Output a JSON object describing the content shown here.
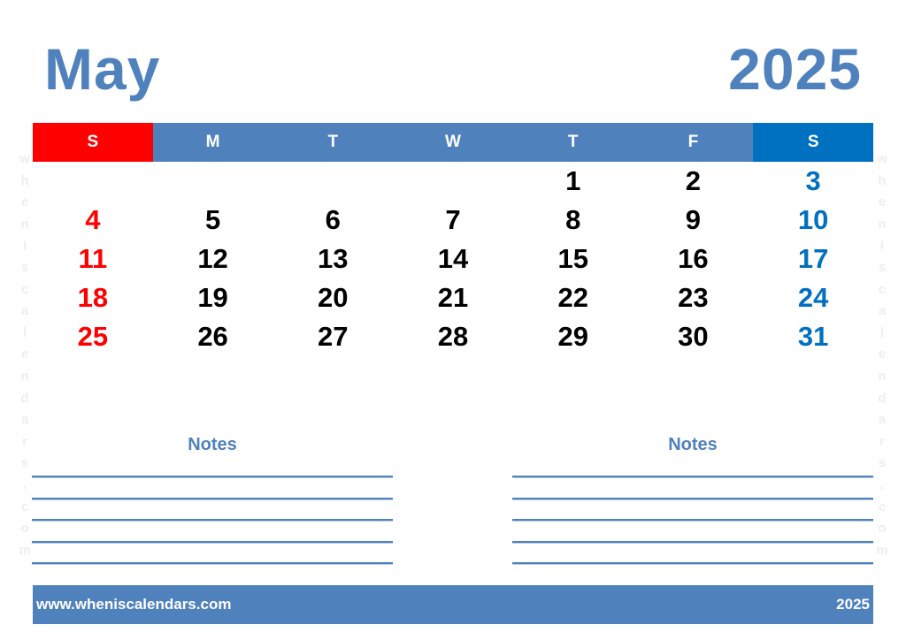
{
  "header": {
    "month": "May",
    "year": "2025"
  },
  "weekdays": [
    {
      "label": "S",
      "type": "sun"
    },
    {
      "label": "M",
      "type": "weekday"
    },
    {
      "label": "T",
      "type": "weekday"
    },
    {
      "label": "W",
      "type": "weekday"
    },
    {
      "label": "T",
      "type": "weekday"
    },
    {
      "label": "F",
      "type": "weekday"
    },
    {
      "label": "S",
      "type": "sat"
    }
  ],
  "weeks": [
    [
      "",
      "",
      "",
      "",
      "1",
      "2",
      "3"
    ],
    [
      "4",
      "5",
      "6",
      "7",
      "8",
      "9",
      "10"
    ],
    [
      "11",
      "12",
      "13",
      "14",
      "15",
      "16",
      "17"
    ],
    [
      "18",
      "19",
      "20",
      "21",
      "22",
      "23",
      "24"
    ],
    [
      "25",
      "26",
      "27",
      "28",
      "29",
      "30",
      "31"
    ]
  ],
  "notes": {
    "left_title": "Notes",
    "right_title": "Notes",
    "line_count": 5
  },
  "watermark": {
    "text": "wheniscalendars.com"
  },
  "footer": {
    "website": "www.wheniscalendars.com",
    "year": "2025"
  },
  "colors": {
    "accent": "#4f81bd",
    "sunday": "#ff0000",
    "saturday": "#0070c0"
  }
}
